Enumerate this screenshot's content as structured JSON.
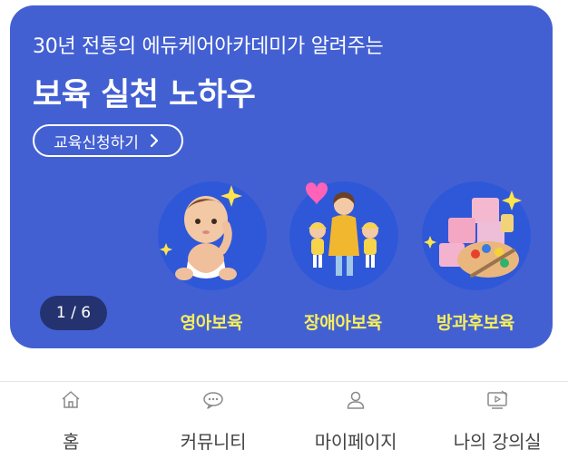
{
  "banner": {
    "subtitle": "30년 전통의 에듀케어아카데미가 알려주는",
    "title": "보육 실천 노하우",
    "cta_label": "교육신청하기",
    "background_color": "#4360d3",
    "pager": "1 / 6",
    "categories": [
      {
        "label": "영아보육",
        "icon": "baby-icon"
      },
      {
        "label": "장애아보육",
        "icon": "family-icon"
      },
      {
        "label": "방과후보육",
        "icon": "blocks-palette-icon"
      }
    ]
  },
  "nav": {
    "items": [
      {
        "label": "홈",
        "icon": "home-icon"
      },
      {
        "label": "커뮤니티",
        "icon": "chat-icon"
      },
      {
        "label": "마이페이지",
        "icon": "user-icon"
      },
      {
        "label": "나의 강의실",
        "icon": "video-lecture-icon"
      }
    ]
  }
}
